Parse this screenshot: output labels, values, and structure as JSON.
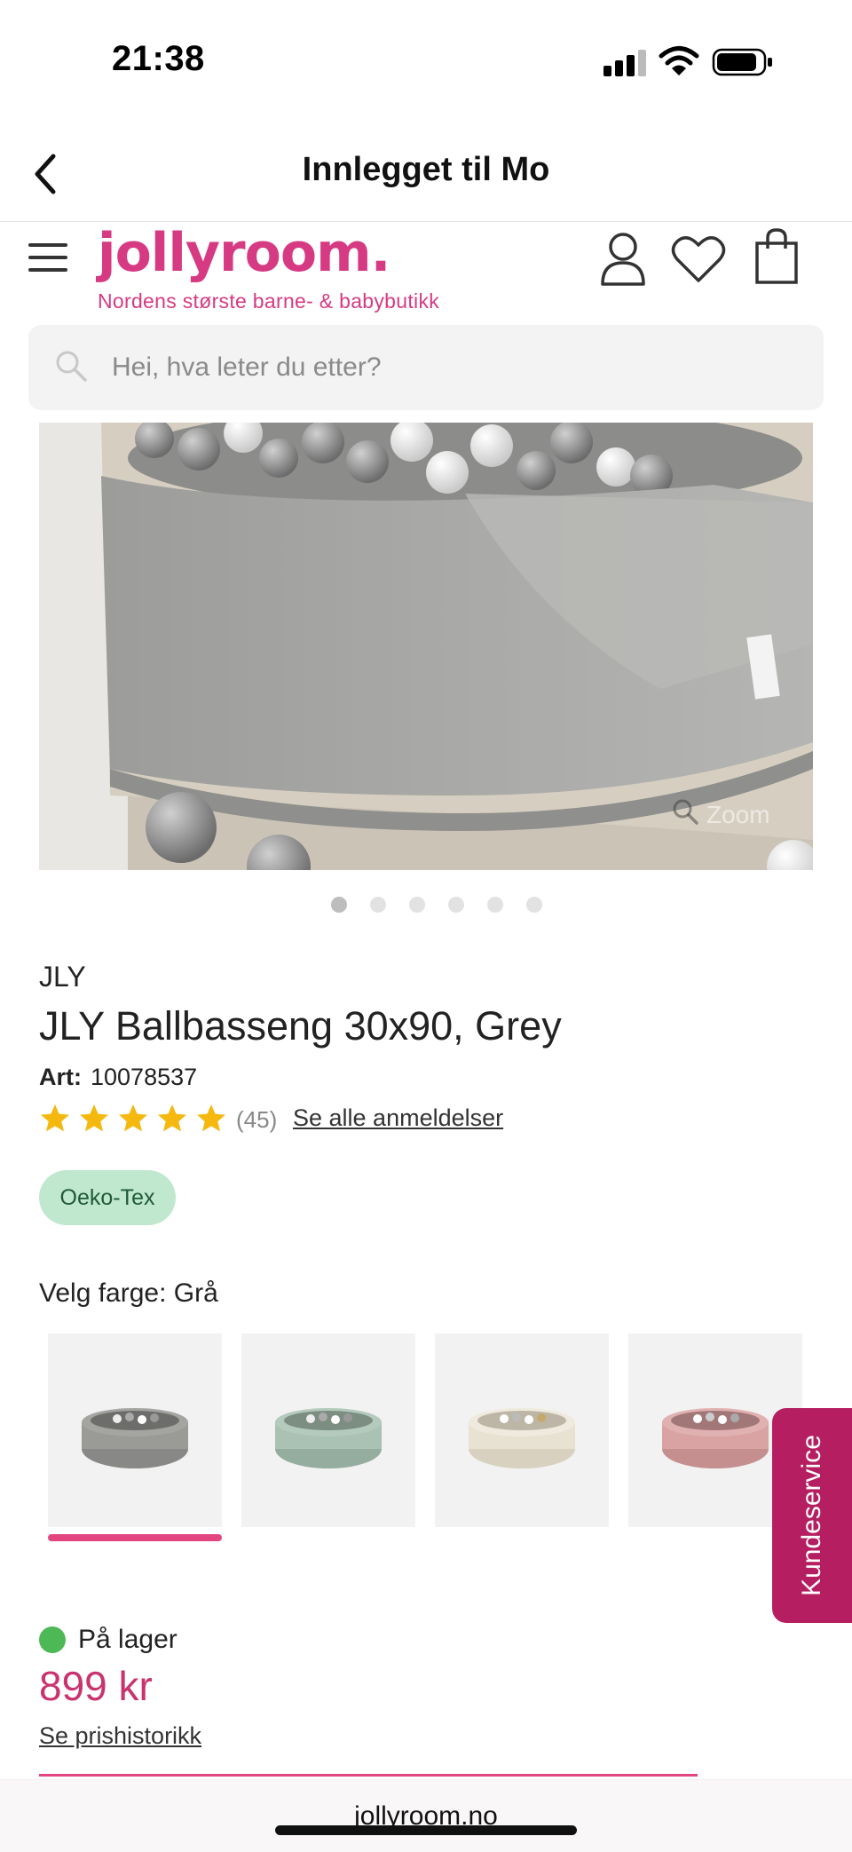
{
  "status_bar": {
    "time": "21:38"
  },
  "nav": {
    "title": "Innlegget til Mo"
  },
  "site": {
    "logo": "jollyroom.",
    "tagline": "Nordens største barne- & babybutikk"
  },
  "search": {
    "placeholder": "Hei, hva leter du etter?"
  },
  "gallery": {
    "zoom_label": "Zoom",
    "dot_count": 6,
    "active_index": 0
  },
  "product": {
    "brand": "JLY",
    "title": "JLY Ballbasseng 30x90, Grey",
    "art_label": "Art:",
    "art_number": "10078537",
    "rating": 5,
    "review_count": "(45)",
    "reviews_link": "Se alle anmeldelser",
    "badge": "Oeko-Tex",
    "color_label": "Velg farge: Grå",
    "swatches": [
      {
        "color": "Grå",
        "tone": "#9a9a96",
        "selected": true
      },
      {
        "color": "Mint",
        "tone": "#a9c2b3",
        "selected": false
      },
      {
        "color": "Kremhvit",
        "tone": "#e8e2d3",
        "selected": false
      },
      {
        "color": "Rosa",
        "tone": "#d9a3a3",
        "selected": false
      }
    ],
    "stock": "På lager",
    "price": "899 kr",
    "price_history_link": "Se prishistorikk"
  },
  "customer_service": {
    "label": "Kundeservice"
  },
  "browser": {
    "url": "jollyroom.no"
  },
  "colors": {
    "brand_pink": "#d63a83",
    "cta_magenta": "#b51f62",
    "in_stock": "#4cb956",
    "star": "#f5b80f"
  }
}
